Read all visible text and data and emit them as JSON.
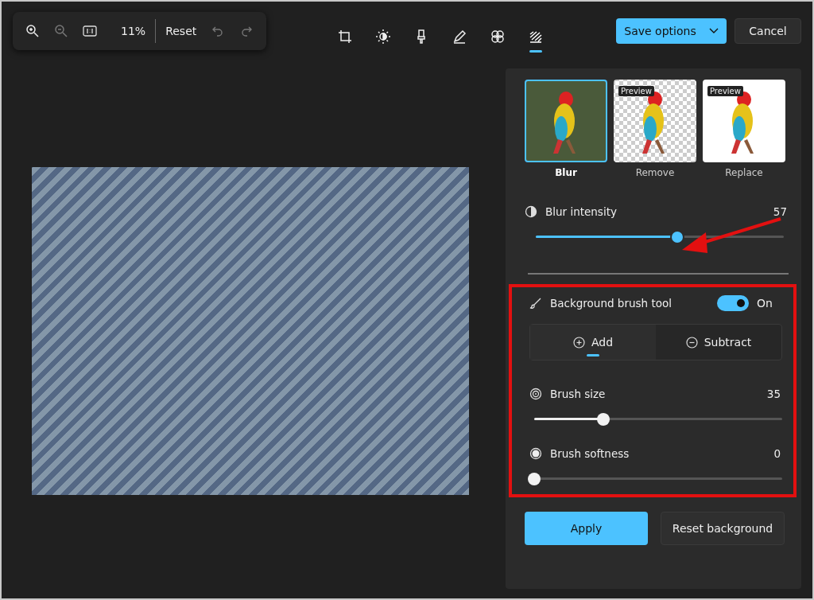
{
  "toolbar": {
    "zoom_level": "11%",
    "reset": "Reset",
    "tools": [
      {
        "kind": "crop",
        "selected": false
      },
      {
        "kind": "adjust",
        "selected": false
      },
      {
        "kind": "marker",
        "selected": false
      },
      {
        "kind": "pen",
        "selected": false
      },
      {
        "kind": "filter",
        "selected": false
      },
      {
        "kind": "background",
        "selected": true
      }
    ],
    "save": "Save options",
    "cancel": "Cancel"
  },
  "panel": {
    "modes": [
      {
        "label": "Blur",
        "kind": "blur",
        "selected": true
      },
      {
        "label": "Remove",
        "kind": "transparent",
        "badge": "Preview",
        "selected": false
      },
      {
        "label": "Replace",
        "kind": "white",
        "badge": "Preview",
        "selected": false
      }
    ],
    "blur_intensity": {
      "label": "Blur intensity",
      "value": "57",
      "level": 0.57
    },
    "brush_tool": {
      "label": "Background brush tool",
      "on": true,
      "state_label": "On"
    },
    "brush_modes": [
      {
        "label": "Add",
        "kind": "add",
        "selected": true
      },
      {
        "label": "Subtract",
        "kind": "subtract",
        "selected": false
      }
    ],
    "sliders": [
      {
        "label": "Brush size",
        "kind": "size",
        "value": "35",
        "level": 0.28
      },
      {
        "label": "Brush softness",
        "kind": "softness",
        "value": "0",
        "level": 0
      }
    ],
    "apply": "Apply",
    "reset_background": "Reset background"
  }
}
